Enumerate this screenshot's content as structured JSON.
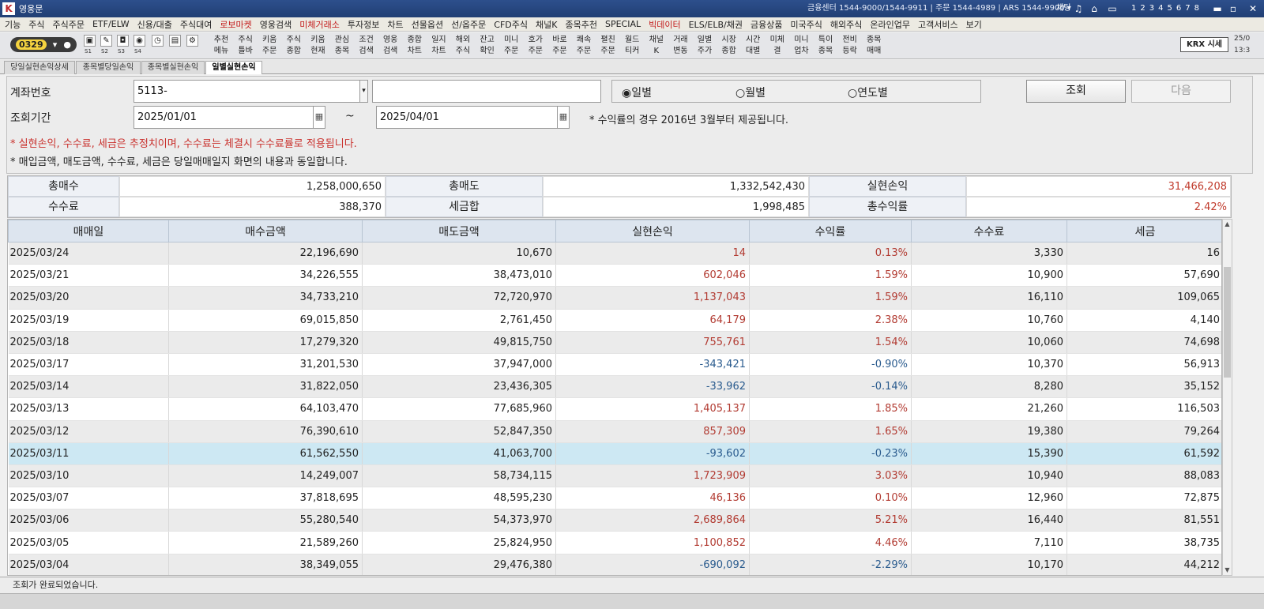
{
  "window": {
    "title": "영웅문",
    "info": "금융센터 1544-9000/1544-9911  |  주문 1544-4989  |  ARS 1544-9900  ▾",
    "chat": "채팅",
    "screen_nums": [
      "1",
      "2",
      "3",
      "4",
      "5",
      "6",
      "7",
      "8"
    ]
  },
  "menu": [
    "기능",
    "주식",
    "주식주문",
    "ETF/ELW",
    "신용/대출",
    "주식대여",
    "로보마켓",
    "영웅검색",
    "미체거래소",
    "투자정보",
    "차트",
    "선물옵션",
    "선/옵주문",
    "CFD주식",
    "채널K",
    "종목추천",
    "SPECIAL",
    "빅데이터",
    "ELS/ELB/채권",
    "금융상품",
    "미국주식",
    "해외주식",
    "온라인업무",
    "고객서비스",
    "보기"
  ],
  "menu_red": [
    "로보마켓",
    "미체거래소",
    "빅데이터"
  ],
  "toolbar": {
    "code": "0329",
    "slots": [
      "S1",
      "S2",
      "S3",
      "S4"
    ],
    "buttons": [
      "추천\n메뉴",
      "주식\n틀바",
      "키움\n주문",
      "주식\n종합",
      "키움\n현재",
      "관심\n종목",
      "조건\n검색",
      "영웅\n검색",
      "종합\n차트",
      "일지\n차트",
      "해외\n주식",
      "잔고\n확인",
      "미니\n주문",
      "호가\n주문",
      "바로\n주문",
      "쾌속\n주문",
      "펼친\n주문",
      "월드\n티커",
      "채널\nK",
      "거래\n변동",
      "일별\n주가",
      "시장\n종합",
      "시간\n대별",
      "미체\n결",
      "미니\n업차",
      "특이\n종목",
      "전비\n등락",
      "종목\n매매"
    ],
    "krx": "KRX 시세",
    "date": "25/0",
    "time": "13:3"
  },
  "tabs": [
    "당일실현손익상세",
    "종목별당일손익",
    "종목별실현손익",
    "일별실현손익"
  ],
  "form": {
    "account_label": "계좌번호",
    "account_value": "5113-",
    "account_name": "",
    "period_label": "조회기간",
    "date_from": "2025/01/01",
    "tilde": "~",
    "date_to": "2025/04/01",
    "radios": [
      "일별",
      "월별",
      "연도별"
    ],
    "search_btn": "조회",
    "next_btn": "다음",
    "note_period": "* 수익률의 경우 2016년 3월부터 제공됩니다.",
    "note1": "* 실현손익, 수수료, 세금은 추정치이며, 수수료는 체결시 수수료률로 적용됩니다.",
    "note2": "* 매입금액, 매도금액, 수수료, 세금은 당일매매일지 화면의 내용과 동일합니다."
  },
  "summary": {
    "total_buy_label": "총매수",
    "total_buy": "1,258,000,650",
    "total_sell_label": "총매도",
    "total_sell": "1,332,542,430",
    "realized_label": "실현손익",
    "realized": "31,466,208",
    "fee_label": "수수료",
    "fee": "388,370",
    "tax_label": "세금합",
    "tax": "1,998,485",
    "rate_label": "총수익률",
    "rate": "2.42%"
  },
  "table": {
    "columns": [
      "매매일",
      "매수금액",
      "매도금액",
      "실현손익",
      "수익률",
      "수수료",
      "세금"
    ],
    "rows": [
      [
        "2025/03/24",
        "22,196,690",
        "10,670",
        "14",
        "0.13%",
        "3,330",
        "16"
      ],
      [
        "2025/03/21",
        "34,226,555",
        "38,473,010",
        "602,046",
        "1.59%",
        "10,900",
        "57,690"
      ],
      [
        "2025/03/20",
        "34,733,210",
        "72,720,970",
        "1,137,043",
        "1.59%",
        "16,110",
        "109,065"
      ],
      [
        "2025/03/19",
        "69,015,850",
        "2,761,450",
        "64,179",
        "2.38%",
        "10,760",
        "4,140"
      ],
      [
        "2025/03/18",
        "17,279,320",
        "49,815,750",
        "755,761",
        "1.54%",
        "10,060",
        "74,698"
      ],
      [
        "2025/03/17",
        "31,201,530",
        "37,947,000",
        "-343,421",
        "-0.90%",
        "10,370",
        "56,913"
      ],
      [
        "2025/03/14",
        "31,822,050",
        "23,436,305",
        "-33,962",
        "-0.14%",
        "8,280",
        "35,152"
      ],
      [
        "2025/03/13",
        "64,103,470",
        "77,685,960",
        "1,405,137",
        "1.85%",
        "21,260",
        "116,503"
      ],
      [
        "2025/03/12",
        "76,390,610",
        "52,847,350",
        "857,309",
        "1.65%",
        "19,380",
        "79,264"
      ],
      [
        "2025/03/11",
        "61,562,550",
        "41,063,700",
        "-93,602",
        "-0.23%",
        "15,390",
        "61,592"
      ],
      [
        "2025/03/10",
        "14,249,007",
        "58,734,115",
        "1,723,909",
        "3.03%",
        "10,940",
        "88,083"
      ],
      [
        "2025/03/07",
        "37,818,695",
        "48,595,230",
        "46,136",
        "0.10%",
        "12,960",
        "72,875"
      ],
      [
        "2025/03/06",
        "55,280,540",
        "54,373,970",
        "2,689,864",
        "5.21%",
        "16,440",
        "81,551"
      ],
      [
        "2025/03/05",
        "21,589,260",
        "25,824,950",
        "1,100,852",
        "4.46%",
        "7,110",
        "38,735"
      ],
      [
        "2025/03/04",
        "38,349,055",
        "29,476,380",
        "-690,092",
        "-2.29%",
        "10,170",
        "44,212"
      ]
    ],
    "selected_row": 9
  },
  "status": "조회가 완료되었습니다.",
  "colors": {
    "positive": "#b23b32",
    "negative": "#2a5b8e",
    "selected": "#cde8f3"
  }
}
